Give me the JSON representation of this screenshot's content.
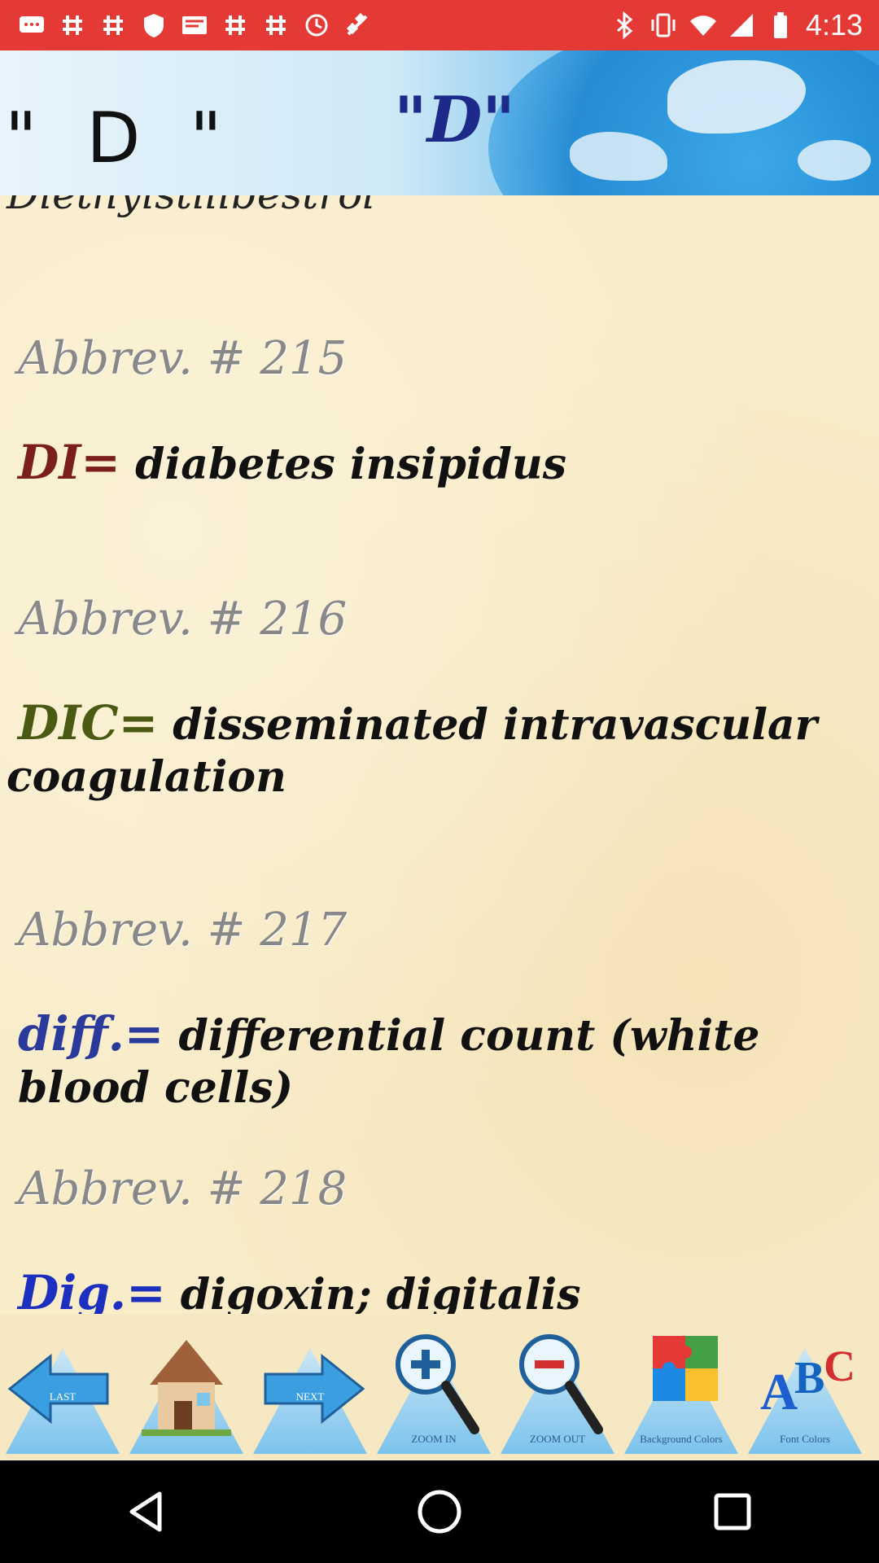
{
  "status_bar": {
    "time": "4:13",
    "left_icons": [
      "chat-icon",
      "hash-icon",
      "hash-icon",
      "shield-icon",
      "message-icon",
      "hash-icon",
      "hash-icon",
      "sync-icon",
      "satellite-icon"
    ],
    "right_icons": [
      "bluetooth-icon",
      "vibrate-icon",
      "wifi-icon",
      "signal-icon",
      "battery-icon"
    ]
  },
  "header": {
    "title_left": "\"  D  \"",
    "title_center": "\"D\""
  },
  "content": {
    "top_entry": "Diethylstillbestrol",
    "entries": [
      {
        "number_label": "Abbrev. # 215",
        "term": "DI=",
        "definition": " diabetes insipidus",
        "term_color": "#7a1e1e"
      },
      {
        "number_label": "Abbrev. # 216",
        "term": "DIC=",
        "definition": " disseminated intravascular coagulation",
        "term_color": "#4a5a12"
      },
      {
        "number_label": "Abbrev. # 217",
        "term": "diff.=",
        "definition": " differential count (white blood cells)",
        "term_color": "#2a3a9a"
      },
      {
        "number_label": "Abbrev. # 218",
        "term": "Dig.=",
        "definition": " digoxin; digitalis",
        "term_color": "#1d2fbf"
      }
    ]
  },
  "toolbar": {
    "buttons": [
      {
        "name": "last-button",
        "label": "LAST",
        "icon": "left-arrow-icon"
      },
      {
        "name": "home-button",
        "label": "",
        "icon": "house-icon"
      },
      {
        "name": "next-button",
        "label": "NEXT",
        "icon": "right-arrow-icon"
      },
      {
        "name": "zoom-in-button",
        "label": "ZOOM IN",
        "icon": "zoom-in-icon"
      },
      {
        "name": "zoom-out-button",
        "label": "ZOOM OUT",
        "icon": "zoom-out-icon"
      },
      {
        "name": "background-colors-button",
        "label": "Background Colors",
        "icon": "puzzle-icon"
      },
      {
        "name": "font-colors-button",
        "label": "Font Colors",
        "icon": "abc-icon"
      }
    ]
  },
  "nav": {
    "back": "back-icon",
    "home": "home-icon",
    "recents": "recents-icon"
  }
}
